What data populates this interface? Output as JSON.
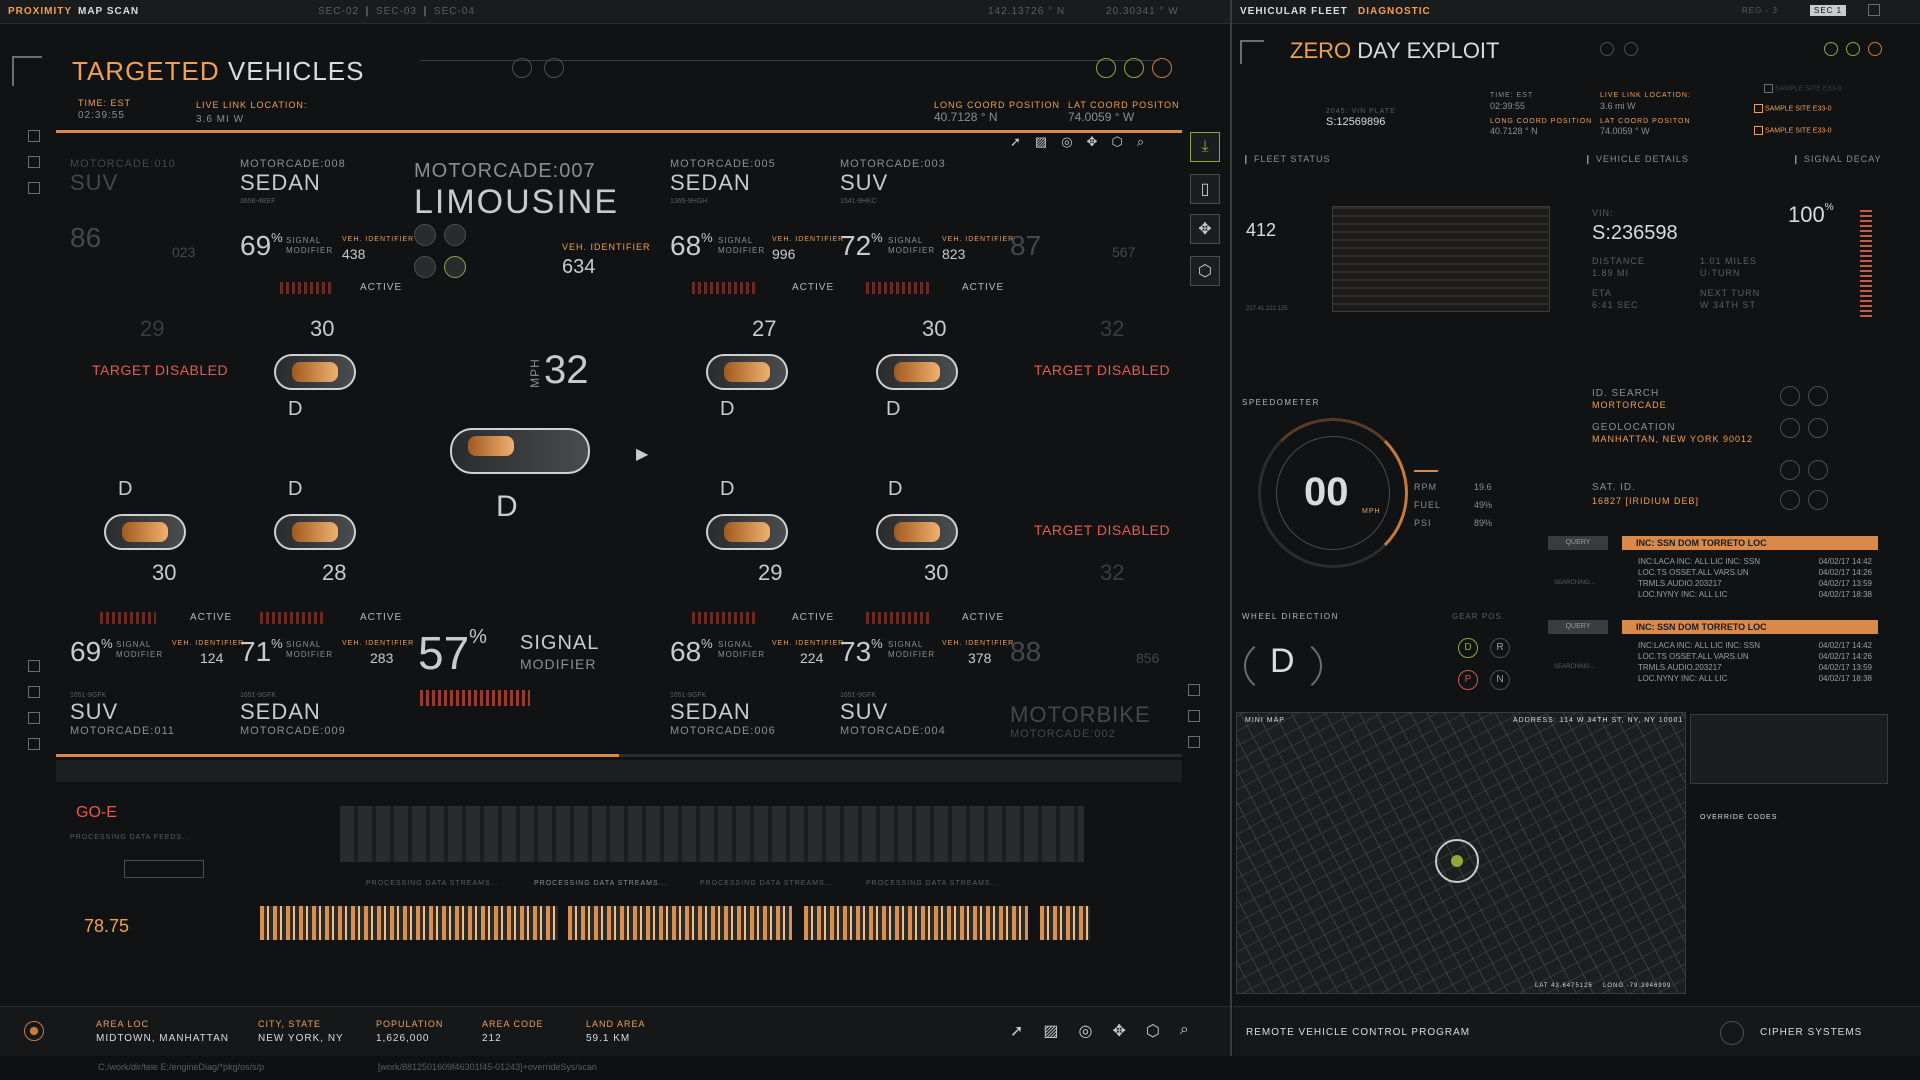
{
  "topbar": {
    "left_title_a": "PROXIMITY",
    "left_title_b": "MAP SCAN",
    "sectors": "SEC-02 ❙ SEC-03 ❙ SEC-04",
    "coord_n": "142.13726 ° N",
    "coord_w": "20.30341 ° W",
    "right_title_a": "VEHICULAR FLEET",
    "right_title_b": "DIAGNOSTIC",
    "reg": "REG - 3",
    "sec_badge": "SEC 1"
  },
  "left_panel": {
    "title_a": "TARGETED",
    "title_b": "VEHICLES",
    "time_label": "TIME: EST",
    "time_value": "02:39:55",
    "live_link_label": "LIVE LINK LOCATION:",
    "live_link_value": "3.6 mi W",
    "long_label": "LONG COORD POSITION",
    "long_value": "40.7128 ° N",
    "lat_label": "LAT COORD POSITON",
    "lat_value": "74.0059 ° W",
    "signal_label": "SIGNAL",
    "modifier_label": "MODIFIER",
    "veh_id_label": "VEH. IDENTIFIER",
    "active_label": "ACTIVE",
    "target_disabled": "TARGET DISABLED",
    "mph_label": "mph"
  },
  "top_cards": [
    {
      "model": "MOTORCADE:010",
      "type": "SUV",
      "pct": "86",
      "vid": "023",
      "faded": true
    },
    {
      "model": "MOTORCADE:008",
      "type": "SEDAN",
      "pct": "69",
      "vid": "438",
      "code": "3658-4BEF"
    },
    {
      "model": "MOTORCADE:007",
      "type": "LIMOUSINE",
      "vid": "634"
    },
    {
      "model": "MOTORCADE:005",
      "type": "SEDAN",
      "pct": "68",
      "vid": "996",
      "code": "1365-9HGH"
    },
    {
      "model": "MOTORCADE:003",
      "type": "SUV",
      "pct": "72",
      "vid": "823",
      "code": "1541-9HKC"
    },
    {
      "model": "",
      "type": "",
      "pct": "87",
      "vid": "567",
      "faded": true
    }
  ],
  "bottom_cards": [
    {
      "model": "MOTORCADE:011",
      "type": "SUV",
      "pct": "69",
      "vid": "124",
      "code": "1651-9GFK"
    },
    {
      "model": "MOTORCADE:009",
      "type": "SEDAN",
      "pct": "71",
      "vid": "283",
      "code": "1651-9GFK"
    },
    {
      "model": "MOTORCADE:006",
      "type": "SEDAN",
      "pct": "68",
      "vid": "224",
      "code": "1651-9GFK"
    },
    {
      "model": "MOTORCADE:004",
      "type": "SUV",
      "pct": "73",
      "vid": "378",
      "code": "1651-9GFK"
    },
    {
      "model": "MOTORCADE:002",
      "type": "MOTORBIKE",
      "pct": "88",
      "vid": "856",
      "faded": true
    }
  ],
  "center": {
    "speed": "32",
    "gear": "D",
    "signal_pct": "57",
    "signal": "SIGNAL",
    "modifier": "MODIFIER"
  },
  "lanes": {
    "s1": "30",
    "s2": "27",
    "s3": "30",
    "s4": "29",
    "s5": "30",
    "s6": "28",
    "s7": "29",
    "s8": "30",
    "faded1": "29",
    "faded2": "32",
    "faded3": "32",
    "gear": "D"
  },
  "data_feeds": {
    "label": "PROCESSING DATA FEEDS...",
    "streams": [
      "PROCESSING DATA STREAMS...",
      "PROCESSING DATA STREAMS...",
      "PROCESSING DATA STREAMS...",
      "PROCESSING DATA STREAMS..."
    ],
    "search_value": "78.75",
    "go_label": "GO-E"
  },
  "bottom_info": {
    "area_loc_label": "AREA LOC",
    "area_loc": "MIDTOWN, MANHATTAN",
    "city_label": "CITY, STATE",
    "city": "NEW YORK, NY",
    "pop_label": "POPULATION",
    "pop": "1,626,000",
    "code_label": "AREA CODE",
    "code": "212",
    "land_label": "LAND AREA",
    "land": "59.1 km"
  },
  "footer": {
    "path_a": "C:/work/dir/tele E:/engineDiag/*pkg/os/s/p",
    "path_b": "[work/8812501609f46301f45-01243]+overrideSys/scan"
  },
  "right_panel": {
    "title_a": "ZERO",
    "title_b": "DAY EXPLOIT",
    "vin_plate_label": "2045: VIN PLATE",
    "vin_plate": "S:12569896",
    "time_label": "TIME: EST",
    "time_value": "02:39:55",
    "live_link_label": "LIVE LINK LOCATION:",
    "live_link_value": "3.6 mi W",
    "long_label": "LONG COORD POSITION",
    "long_value": "40.7128 ° N",
    "lat_label": "LAT COORD POSITON",
    "lat_value": "74.0059 ° W",
    "sample_sites": [
      "SAMPLE SITE E33-0",
      "SAMPLE SITE E33-0",
      "SAMPLE SITE E33-0"
    ],
    "tabs": [
      "FLEET STATUS",
      "VEHICLE DETAILS",
      "SIGNAL DECAY"
    ],
    "fleet_number": "412",
    "fleet_ip": "227.41.222.135",
    "vin_label": "VIN:",
    "vin": "S:236598",
    "vin_pct": "100",
    "distance_label": "DISTANCE",
    "distance": "1.89 mi",
    "miles": "1.01 MILES",
    "uturn": "U-TURN",
    "eta_label": "ETA",
    "eta": "6:41 sec",
    "next_turn_label": "NEXT TURN",
    "next_turn": "W 34TH ST",
    "speedometer_label": "SPEEDOMETER",
    "speed": "00",
    "speed_unit": "MPH",
    "rpm_label": "RPM",
    "rpm": "19.6",
    "fuel_label": "FUEL",
    "fuel": "49%",
    "psi_label": "PSI",
    "psi": "89%",
    "id_search_label": "ID. SEARCH",
    "id_search": "MORTORCADE",
    "geo_label": "GEOLOCATION",
    "geo": "MANHATTAN, NEW YORK 90012",
    "sat_label": "SAT. ID.",
    "sat": "16827 [IRIDIUM DEB]",
    "wheel_label": "WHEEL DIRECTION",
    "gear_pos_label": "GEAR POS.",
    "wheel_gear": "D",
    "gears": [
      "D",
      "R",
      "P",
      "N"
    ],
    "query_label": "QUERY",
    "inc_label": "INC: SSN DOM TORRETO LOC",
    "searching": "SEARCHING...",
    "log_lines": [
      {
        "t": "INC:LACA INC: ALL LIC INC: SSN",
        "d": "04/02/17 14:42"
      },
      {
        "t": "LOC.TS OSSET.ALL VARS.UN",
        "d": "04/02/17 14:26"
      },
      {
        "t": "TRMLS.AUDIO.203217",
        "d": "04/02/17 13:59"
      },
      {
        "t": "LOC.NYNY INC: ALL LIC",
        "d": "04/02/17 18:38"
      }
    ],
    "minimap_label": "MINI MAP",
    "address": "ADDRESS: 114 W 34TH ST, NY, NY 10001",
    "map_lat": "LAT 43.6475125",
    "map_long": "LONG -79.3946999",
    "override_label": "OVERRIDE CODES",
    "remote_label": "REMOTE VEHICLE CONTROL PROGRAM",
    "cipher_label": "CIPHER SYSTEMS"
  }
}
